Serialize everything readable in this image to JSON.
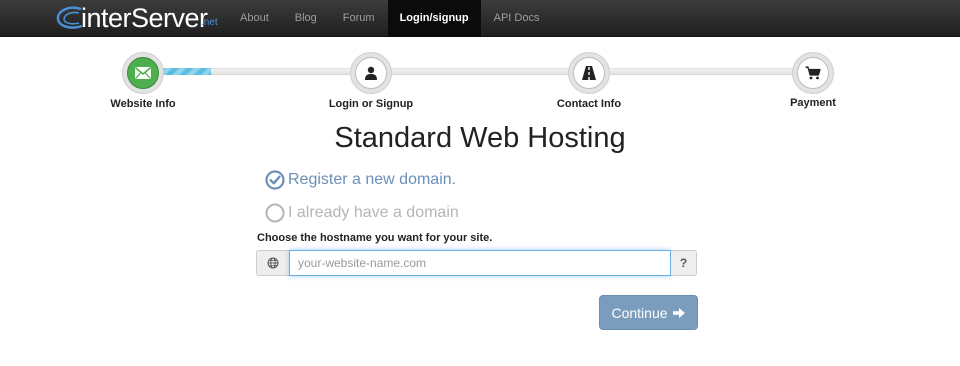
{
  "brand": {
    "name": "interServer",
    "tld": ".net"
  },
  "nav": {
    "items": [
      {
        "label": "About"
      },
      {
        "label": "Blog"
      },
      {
        "label": "Forum"
      },
      {
        "label": "Login/signup",
        "active": true
      },
      {
        "label": "API Docs"
      }
    ]
  },
  "wizard": {
    "progress": 0.1,
    "steps": [
      {
        "label": "Website Info",
        "icon": "envelope-icon",
        "status": "complete"
      },
      {
        "label": "Login or Signup",
        "icon": "user-icon",
        "status": "pending"
      },
      {
        "label": "Contact Info",
        "icon": "road-icon",
        "status": "pending"
      },
      {
        "label": "Payment",
        "icon": "cart-icon",
        "status": "pending"
      }
    ]
  },
  "main": {
    "title": "Standard Web Hosting",
    "options": [
      {
        "label": "Register a new domain.",
        "selected": true
      },
      {
        "label": "I already have a domain",
        "selected": false
      }
    ],
    "hostname": {
      "label": "Choose the hostname you want for your site.",
      "placeholder": "your-website-name.com",
      "value": "",
      "help": "?"
    },
    "continue_label": "Continue"
  },
  "colors": {
    "accent": "#6c8fb8",
    "complete": "#4cae4c",
    "button": "#7a9cbd",
    "progress": "#5bc0de"
  }
}
